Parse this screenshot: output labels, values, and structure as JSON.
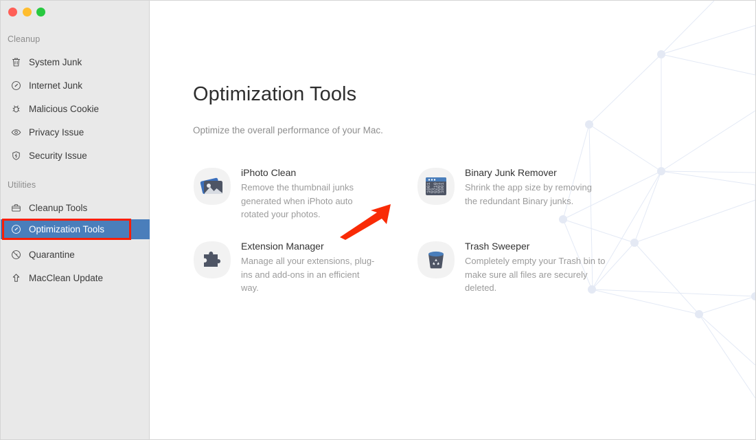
{
  "window": {
    "traffic_lights": [
      {
        "name": "close",
        "color": "#ff5f57"
      },
      {
        "name": "minimize",
        "color": "#ffbd2e"
      },
      {
        "name": "maximize",
        "color": "#28c940"
      }
    ]
  },
  "sidebar": {
    "sections": [
      {
        "label": "Cleanup",
        "items": [
          {
            "label": "System Junk",
            "icon": "trash-icon"
          },
          {
            "label": "Internet Junk",
            "icon": "speedometer-icon"
          },
          {
            "label": "Malicious Cookie",
            "icon": "bug-icon"
          },
          {
            "label": "Privacy Issue",
            "icon": "eye-icon"
          },
          {
            "label": "Security Issue",
            "icon": "shield-bolt-icon"
          }
        ]
      },
      {
        "label": "Utilities",
        "items": [
          {
            "label": "Cleanup Tools",
            "icon": "briefcase-icon"
          },
          {
            "label": "Optimization Tools",
            "icon": "compass-icon",
            "selected": true
          },
          {
            "label": "Quarantine",
            "icon": "no-entry-icon"
          },
          {
            "label": "MacClean Update",
            "icon": "up-arrow-icon"
          }
        ]
      }
    ],
    "selected_item": "Optimization Tools",
    "selection_color": "#4a7ebb",
    "annotation_color": "#fa1e05"
  },
  "main": {
    "title": "Optimization Tools",
    "subtitle": "Optimize the overall performance of your Mac.",
    "tools": [
      {
        "title": "iPhoto Clean",
        "description": "Remove the thumbnail junks generated when iPhoto auto rotated your photos.",
        "icon": "photos-icon"
      },
      {
        "title": "Binary Junk Remover",
        "description": "Shrink the app size by removing the redundant Binary junks.",
        "icon": "binary-window-icon"
      },
      {
        "title": "Extension Manager",
        "description": "Manage all your extensions, plug-ins and add-ons in an efficient way.",
        "icon": "puzzle-piece-icon"
      },
      {
        "title": "Trash Sweeper",
        "description": "Completely empty your Trash bin to make sure all files are securely deleted.",
        "icon": "trash-bin-icon"
      }
    ]
  },
  "annotations": {
    "arrow": {
      "name": "red-arrow-pointer",
      "color": "#f92b06",
      "points_to": "iPhoto Clean"
    }
  }
}
